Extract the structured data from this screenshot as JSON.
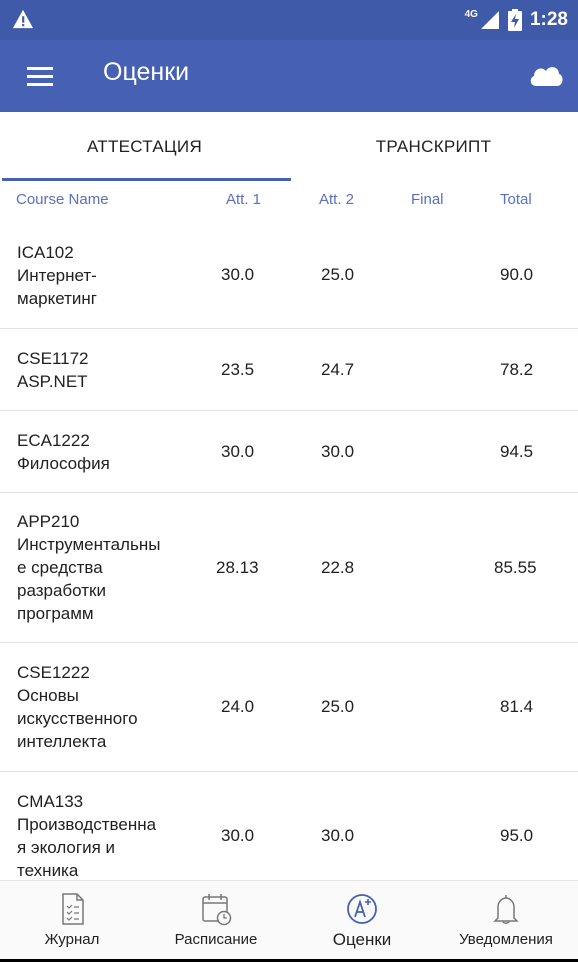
{
  "status": {
    "network": "4G",
    "time": "1:28"
  },
  "appbar": {
    "title": "Оценки"
  },
  "tabs": [
    {
      "label": "АТТЕСТАЦИЯ"
    },
    {
      "label": "ТРАНСКРИПТ"
    }
  ],
  "columns": {
    "name": "Course Name",
    "att1": "Att. 1",
    "att2": "Att. 2",
    "final": "Final",
    "total": "Total"
  },
  "rows": [
    {
      "code": "ICA102",
      "name": "Интернет-маркетинг",
      "name_lines": [
        "Интернет-",
        "маркетинг"
      ],
      "att1": "30.0",
      "att2": "25.0",
      "final": "",
      "total": "90.0"
    },
    {
      "code": "CSE1172",
      "name": "ASP.NET",
      "name_lines": [
        "ASP.NET"
      ],
      "att1": "23.5",
      "att2": "24.7",
      "final": "",
      "total": "78.2"
    },
    {
      "code": "ECA1222",
      "name": "Философия",
      "name_lines": [
        "Философия"
      ],
      "att1": "30.0",
      "att2": "30.0",
      "final": "",
      "total": "94.5"
    },
    {
      "code": "APP210",
      "name": "Инструментальные средства разработки программ",
      "name_lines": [
        "Инструментальны",
        "е средства",
        "разработки",
        "программ"
      ],
      "att1": "28.13",
      "att2": "22.8",
      "final": "",
      "total": "85.55"
    },
    {
      "code": "CSE1222",
      "name": "Основы искусственного интеллекта",
      "name_lines": [
        "Основы",
        "искусственного",
        "интеллекта"
      ],
      "att1": "24.0",
      "att2": "25.0",
      "final": "",
      "total": "81.4"
    },
    {
      "code": "CMA133",
      "name": "Производственная экология и техника",
      "name_lines": [
        "Производственна",
        "я экология и",
        "техника"
      ],
      "att1": "30.0",
      "att2": "30.0",
      "final": "",
      "total": "95.0"
    }
  ],
  "bottom_nav": [
    {
      "label": "Журнал",
      "icon": "journal-icon"
    },
    {
      "label": "Расписание",
      "icon": "calendar-clock-icon"
    },
    {
      "label": "Оценки",
      "icon": "grade-a-plus-icon",
      "active": true
    },
    {
      "label": "Уведомления",
      "icon": "bell-icon"
    }
  ],
  "colors": {
    "primary": "#4660b3",
    "status_bar": "#3f5aa8",
    "header_text": "#5a6fc0"
  }
}
